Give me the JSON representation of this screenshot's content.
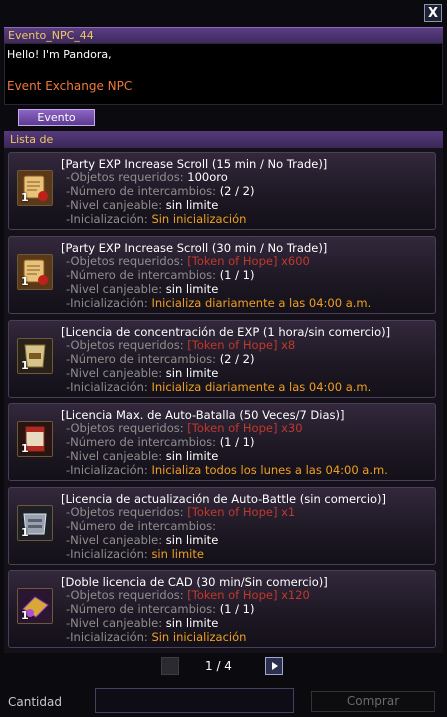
{
  "window": {
    "close_label": "X"
  },
  "npc": {
    "name": "Evento_NPC_44",
    "greeting": "Hello! I'm Pandora,",
    "role": "Event Exchange NPC"
  },
  "tabs": [
    "Evento"
  ],
  "list_title": "Lista de",
  "labels": {
    "req": "-Objetos requeridos:",
    "count": "-Número de intercambios:",
    "level": "-Nivel canjeable:",
    "reset": "-Inicialización:"
  },
  "items": [
    {
      "title": "[Party EXP Increase Scroll (15 min / No Trade)]",
      "qty": "1",
      "icon": "scroll-icon",
      "required": "100oro",
      "exchanges": "(2 / 2)",
      "level": "sin limite",
      "reset": "Sin inicialización"
    },
    {
      "title": "[Party EXP Increase Scroll (30 min / No Trade)]",
      "qty": "1",
      "icon": "scroll-icon",
      "required": "[Token of Hope] x600",
      "exchanges": "(1 / 1)",
      "level": "sin limite",
      "reset": "Inicializa diariamente a las 04:00 a.m."
    },
    {
      "title": "[Licencia de concentración de EXP (1 hora/sin comercio)]",
      "qty": "1",
      "icon": "exp-license-icon",
      "required": "[Token of Hope] x8",
      "exchanges": "(2 / 2)",
      "level": "sin limite",
      "reset": "Inicializa diariamente a las 04:00 a.m."
    },
    {
      "title": "[Licencia Max. de  Auto-Batalla (50 Veces/7 Dias)]",
      "qty": "1",
      "icon": "battle-scroll-icon",
      "required": "[Token of Hope] x30",
      "exchanges": "(1 / 1)",
      "level": "sin limite",
      "reset": "Inicializa todos los lunes a las 04:00 a.m."
    },
    {
      "title": "[Licencia de actualización de Auto-Battle (sin comercio)]",
      "qty": "1",
      "icon": "battle-license-icon",
      "required": "[Token of Hope] x1",
      "exchanges": "",
      "level": "sin limite",
      "reset": "sin limite"
    },
    {
      "title": "[Doble licencia de CAD (30 min/Sin comercio)]",
      "qty": "1",
      "icon": "cad-license-icon",
      "required": "[Token of Hope] x120",
      "exchanges": "(1 / 1)",
      "level": "sin limite",
      "reset": "Sin inicialización"
    }
  ],
  "pagination": {
    "text": "1 / 4"
  },
  "footer": {
    "quantity_label": "Cantidad",
    "buy_label": "Comprar"
  }
}
